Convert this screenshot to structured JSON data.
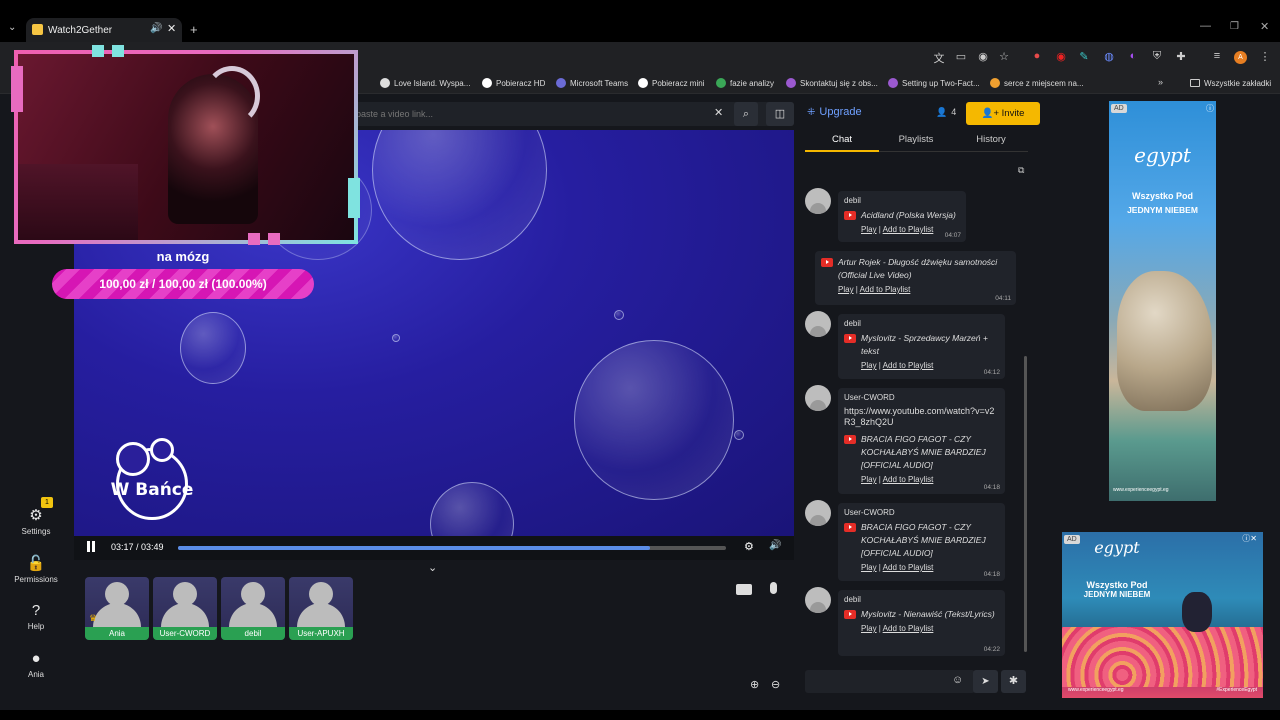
{
  "browser": {
    "tab_title": "Watch2Gether",
    "bookmarks": [
      {
        "label": "Love Island. Wyspa...",
        "color": "#dddddd"
      },
      {
        "label": "Pobieracz HD",
        "color": "#ffffff"
      },
      {
        "label": "Microsoft Teams",
        "color": "#6b6bd6"
      },
      {
        "label": "Pobieracz mini",
        "color": "#ffffff"
      },
      {
        "label": "fazie analizy",
        "color": "#3aa757"
      },
      {
        "label": "Skontaktuj się z obs...",
        "color": "#9b59d0"
      },
      {
        "label": "Setting up Two-Fact...",
        "color": "#9b59d0"
      },
      {
        "label": "serce z miejscem na...",
        "color": "#f0a030"
      }
    ],
    "all_bookmarks": "Wszystkie zakładki",
    "profile_initial": "A"
  },
  "sidebar": {
    "settings": {
      "label": "Settings",
      "badge": "1"
    },
    "permissions": {
      "label": "Permissions"
    },
    "help": {
      "label": "Help"
    },
    "user": {
      "label": "Ania"
    }
  },
  "search": {
    "placeholder": "paste a video link..."
  },
  "overlay": {
    "goal_title": "na mózg",
    "goal_amount": "100,00 zł / 100,00 zł (100.00%)",
    "logo_text": "W Bańce"
  },
  "player": {
    "time": "03:17 / 03:49",
    "progress": 0.862
  },
  "users": [
    {
      "name": "Ania",
      "crown": true
    },
    {
      "name": "User-CWORD",
      "crown": false
    },
    {
      "name": "debil",
      "crown": false
    },
    {
      "name": "User-APUXH",
      "crown": false
    }
  ],
  "header": {
    "upgrade": "Upgrade",
    "user_count": "4",
    "invite": "Invite"
  },
  "tabs": [
    {
      "label": "Chat",
      "active": true
    },
    {
      "label": "Playlists",
      "active": false
    },
    {
      "label": "History",
      "active": false
    }
  ],
  "actions": {
    "play": "Play",
    "add": "Add to Playlist"
  },
  "messages": [
    {
      "user": "debil",
      "song": "Acidland (Polska Wersja)",
      "time": "04:07"
    },
    {
      "user": "",
      "song": "Artur Rojek - Długość dźwięku samotności (Official Live Video)",
      "time": "04:11"
    },
    {
      "user": "debil",
      "song": "Myslovitz - Sprzedawcy Marzeń + tekst",
      "time": "04:12"
    },
    {
      "user": "User-CWORD",
      "link": "https://www.youtube.com/watch?v=v2R3_8zhQ2U",
      "song": "BRACIA FIGO FAGOT - CZY KOCHAŁABYŚ MNIE BARDZIEJ [OFFICIAL AUDIO]",
      "time": "04:18"
    },
    {
      "user": "User-CWORD",
      "song": "BRACIA FIGO FAGOT - CZY KOCHAŁABYŚ MNIE BARDZIEJ [OFFICIAL AUDIO]",
      "time": "04:18"
    },
    {
      "user": "debil",
      "song": "Myslovitz - Nienawiść (Tekst/Lyrics)",
      "time": "04:22"
    }
  ],
  "ads": {
    "tag": "AD",
    "brand": "egypt",
    "tagline_1": "Wszystko Pod",
    "tagline_2": "JEDNYM NIEBEM",
    "url": "www.experienceegypt.eg",
    "hashtag": "#ExperienceEgypt"
  }
}
